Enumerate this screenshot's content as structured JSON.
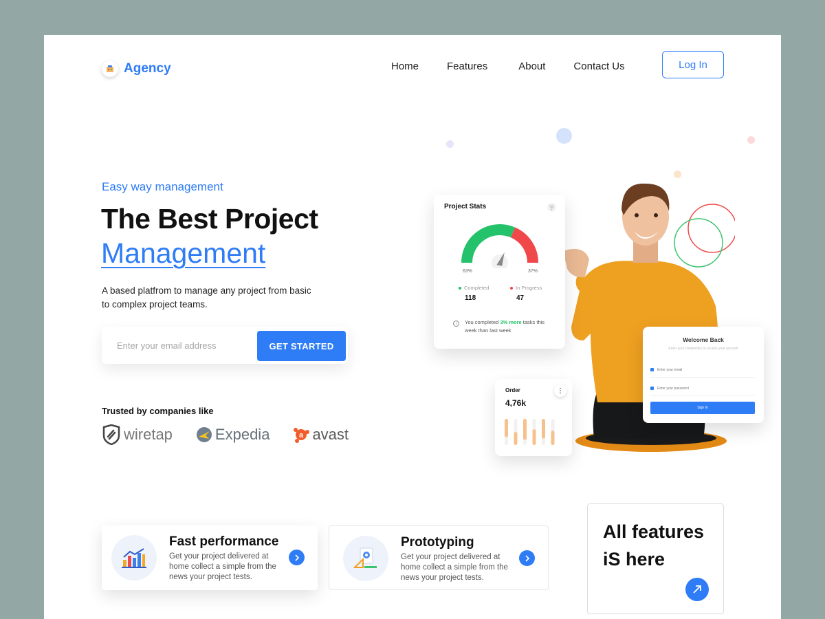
{
  "header": {
    "logo_text": "Agency",
    "nav": [
      "Home",
      "Features",
      "About",
      "Contact Us"
    ],
    "login_label": "Log In"
  },
  "hero": {
    "eyebrow": "Easy way management",
    "title_line1": "The Best Project",
    "title_line2": "Management",
    "description": "A based platfrom to manage any project from basic to complex project teams.",
    "email_placeholder": "Enter your email address",
    "cta_label": "GET STARTED",
    "trusted_label": "Trusted by companies like",
    "brands": [
      "wiretap",
      "Expedia",
      "avast"
    ]
  },
  "stats_card": {
    "title": "Project Stats",
    "completed_pct": "63%",
    "in_progress_pct": "37%",
    "completed_label": "Completed",
    "completed_value": "118",
    "in_progress_label": "In Progress",
    "in_progress_value": "47",
    "note_before": "You completed ",
    "note_highlight": "3% more",
    "note_after": " tasks this week than last week",
    "gauge_completed_fraction": 0.63,
    "colors": {
      "completed": "#23c26b",
      "in_progress": "#f0474a"
    }
  },
  "order_card": {
    "title": "Order",
    "value": "4,76k",
    "menu_icon": "more-vertical-icon",
    "bar_levels": [
      0.7,
      0.5,
      0.8,
      0.6,
      0.75,
      0.55
    ]
  },
  "welcome_card": {
    "title": "Welcome Back",
    "subtitle": "Enter your credentials to access your account",
    "email_placeholder": "Enter your email",
    "password_placeholder": "Enter your password",
    "signin_label": "Sign In"
  },
  "features": [
    {
      "title": "Fast performance",
      "text": "Get your project delivered at home collect a simple from the news your project tests.",
      "icon": "bar-chart-icon"
    },
    {
      "title": "Prototyping",
      "text": "Get your project delivered at home collect a simple from the news your project tests.",
      "icon": "design-tools-icon"
    }
  ],
  "all_features": {
    "title": "All features iS here",
    "icon": "arrow-up-right-icon"
  },
  "colors": {
    "accent": "#2e7cf6",
    "background": "#93a8a5",
    "orange": "#f09a1e"
  }
}
